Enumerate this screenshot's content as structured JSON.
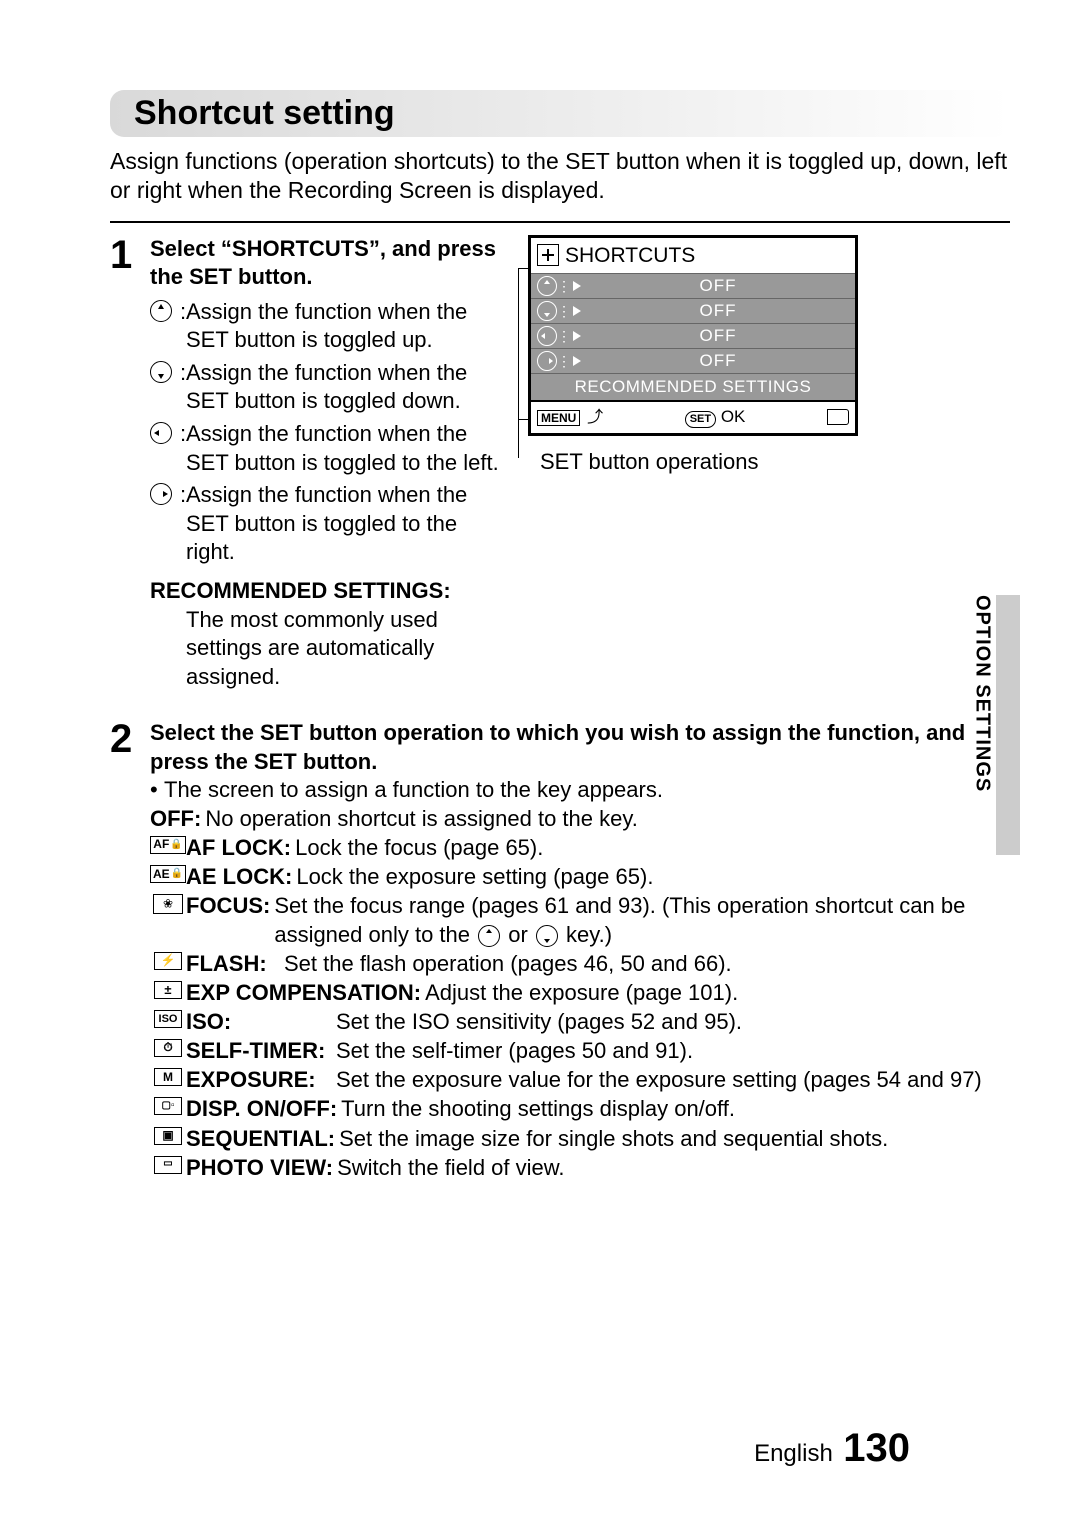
{
  "title": "Shortcut setting",
  "intro": "Assign functions (operation shortcuts) to the SET button when it is toggled up, down, left or right when the Recording Screen is displayed.",
  "side_tab": "OPTION SETTINGS",
  "footer_lang": "English",
  "footer_page": "130",
  "step1": {
    "num": "1",
    "title": "Select “SHORTCUTS”, and press the SET button.",
    "dir_up": "Assign the function when the SET button is toggled up.",
    "dir_down": "Assign the function when the SET button is toggled down.",
    "dir_left": "Assign the function when the SET button is toggled to the left.",
    "dir_right": "Assign the function when the SET button is toggled to the right.",
    "rec_title": "RECOMMENDED SETTINGS:",
    "rec_body": "The most commonly used settings are automatically assigned."
  },
  "screen": {
    "header": "SHORTCUTS",
    "off": "OFF",
    "recommended": "RECOMMENDED SETTINGS",
    "menu": "MENU",
    "set": "SET",
    "ok": "OK",
    "callout": "SET button operations"
  },
  "step2": {
    "num": "2",
    "title": "Select the SET button operation to which you wish to assign the function, and press the SET button.",
    "note": "The screen to assign a function to the key appears.",
    "off_label": "OFF:",
    "off_text": "No operation shortcut is assigned to the key.",
    "items": [
      {
        "label": "AF LOCK:",
        "text": "Lock the focus (page 65)."
      },
      {
        "label": "AE LOCK:",
        "text": "Lock the exposure setting (page 65)."
      },
      {
        "label": "FOCUS:",
        "text_a": "Set the focus range (pages 61 and 93). (This operation shortcut can be assigned only to the ",
        "text_b": " or ",
        "text_c": " key.)"
      },
      {
        "label": "FLASH:",
        "text": "Set the flash operation (pages 46, 50 and 66)."
      },
      {
        "label": "EXP COMPENSATION:",
        "text": "Adjust the exposure (page 101)."
      },
      {
        "label": "ISO:",
        "text": "Set the ISO sensitivity (pages 52 and 95)."
      },
      {
        "label": "SELF-TIMER:",
        "text": "Set the self-timer (pages 50 and 91)."
      },
      {
        "label": "EXPOSURE:",
        "text": "Set the exposure value for the exposure setting (pages 54 and 97)"
      },
      {
        "label": "DISP. ON/OFF:",
        "text": "Turn the shooting settings display on/off."
      },
      {
        "label": "SEQUENTIAL:",
        "text": "Set the image size for single shots and sequential shots."
      },
      {
        "label": "PHOTO VIEW:",
        "text": "Switch the field of view."
      }
    ]
  }
}
